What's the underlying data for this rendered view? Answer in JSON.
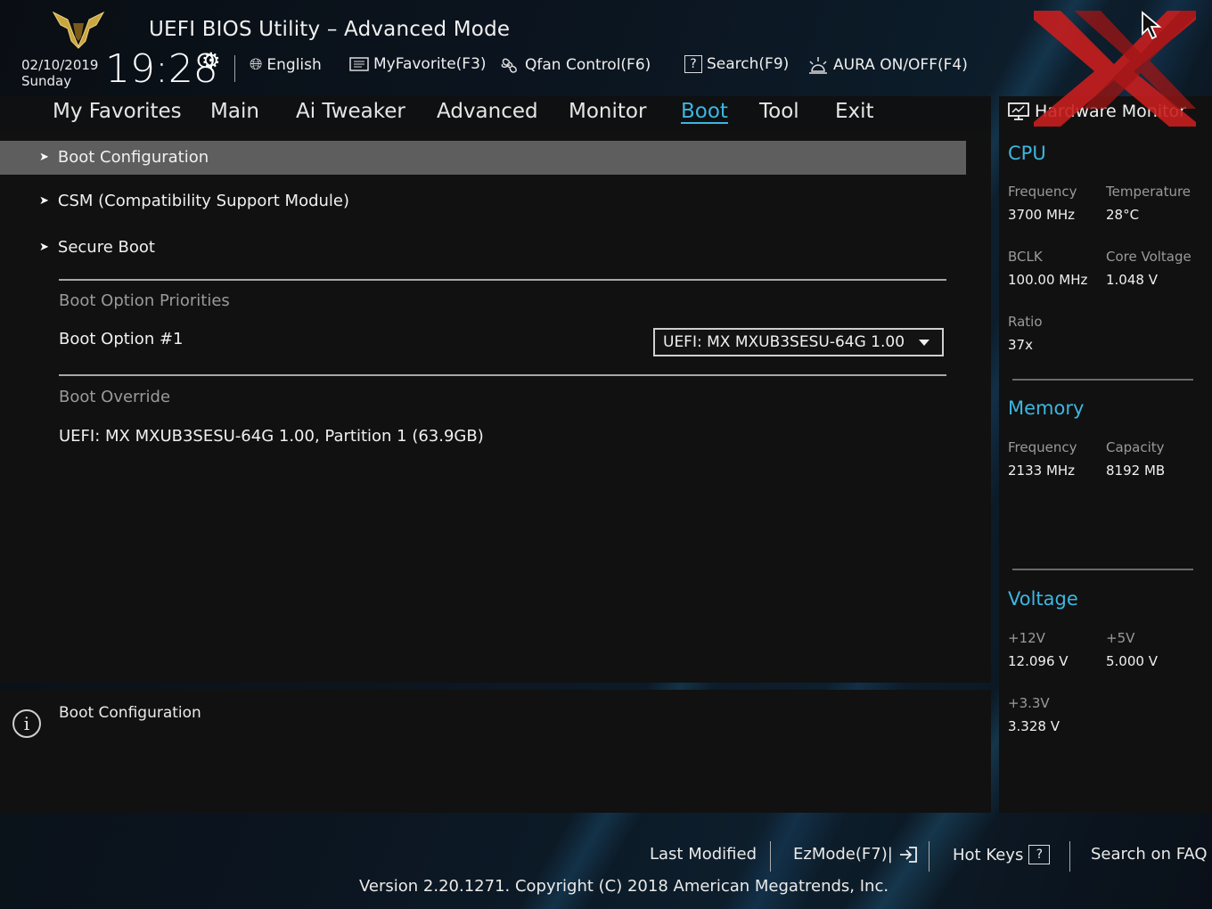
{
  "header": {
    "app_title": "UEFI BIOS Utility – Advanced Mode",
    "date": "02/10/2019",
    "day": "Sunday",
    "time": "19:28",
    "toolbar": {
      "language": "English",
      "my_favorite": "MyFavorite(F3)",
      "qfan": "Qfan Control(F6)",
      "search": "Search(F9)",
      "aura": "AURA ON/OFF(F4)"
    }
  },
  "nav": {
    "tabs": [
      "My Favorites",
      "Main",
      "Ai Tweaker",
      "Advanced",
      "Monitor",
      "Boot",
      "Tool",
      "Exit"
    ],
    "active": "Boot"
  },
  "boot": {
    "menu": [
      "Boot Configuration",
      "CSM (Compatibility Support Module)",
      "Secure Boot"
    ],
    "priorities_label": "Boot Option Priorities",
    "option1_label": "Boot Option #1",
    "option1_value": "UEFI: MX MXUB3SESU-64G 1.00,",
    "override_label": "Boot Override",
    "override_item": "UEFI: MX MXUB3SESU-64G 1.00, Partition 1 (63.9GB)"
  },
  "info": {
    "text": "Boot Configuration"
  },
  "hwmon": {
    "title": "Hardware Monitor",
    "cpu": {
      "title": "CPU",
      "frequency_label": "Frequency",
      "frequency": "3700 MHz",
      "temperature_label": "Temperature",
      "temperature": "28°C",
      "bclk_label": "BCLK",
      "bclk": "100.00 MHz",
      "core_voltage_label": "Core Voltage",
      "core_voltage": "1.048 V",
      "ratio_label": "Ratio",
      "ratio": "37x"
    },
    "memory": {
      "title": "Memory",
      "frequency_label": "Frequency",
      "frequency": "2133 MHz",
      "capacity_label": "Capacity",
      "capacity": "8192 MB"
    },
    "voltage": {
      "title": "Voltage",
      "v12_label": "+12V",
      "v12": "12.096 V",
      "v5_label": "+5V",
      "v5": "5.000 V",
      "v33_label": "+3.3V",
      "v33": "3.328 V"
    }
  },
  "footer": {
    "last_modified": "Last Modified",
    "ezmode": "EzMode(F7)|",
    "hot_keys": "Hot Keys",
    "search_faq": "Search on FAQ",
    "version": "Version 2.20.1271. Copyright (C) 2018 American Megatrends, Inc."
  },
  "colors": {
    "accent": "#3db6e0",
    "selected_row": "#5e5e5e",
    "watermark": "#c81e1e"
  },
  "icons": [
    "tuf-logo-icon",
    "gear-icon",
    "globe-icon",
    "favorite-list-icon",
    "fan-icon",
    "help-icon",
    "aura-light-icon",
    "monitor-icon",
    "info-icon",
    "exit-arrow-icon",
    "cursor-icon"
  ]
}
